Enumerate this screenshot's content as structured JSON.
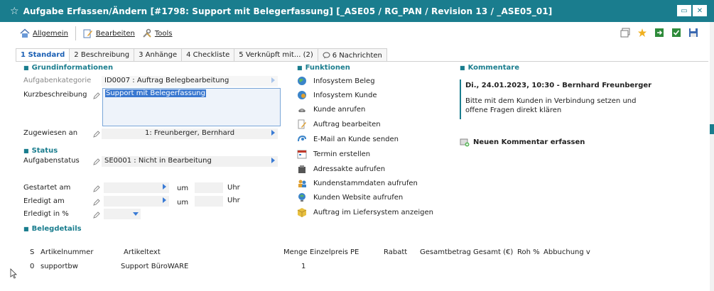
{
  "window": {
    "title": "Aufgabe Erfassen/Ändern [#1798: Support mit Belegerfassung] [_ASE05 / RG_PAN / Revision 13 / _ASE05_01]",
    "restore_label": "▭",
    "close_label": "✕"
  },
  "toolbar": {
    "allgemein": "Allgemein",
    "bearbeiten": "Bearbeiten",
    "tools": "Tools"
  },
  "tabs": [
    {
      "label": "1 Standard"
    },
    {
      "label": "2 Beschreibung"
    },
    {
      "label": "3 Anhänge"
    },
    {
      "label": "4 Checkliste"
    },
    {
      "label": "5 Verknüpft mit... (2)"
    },
    {
      "label": "6 Nachrichten"
    }
  ],
  "grundinfo": {
    "heading": "Grundinformationen",
    "kategorie_label": "Aufgabenkategorie",
    "kategorie_value": "ID0007   : Auftrag Belegbearbeitung",
    "kurz_label": "Kurzbeschreibung",
    "kurz_value": "Support mit Belegerfassung",
    "zugewiesen_label": "Zugewiesen an",
    "zugewiesen_value": "1: Freunberger, Bernhard"
  },
  "status": {
    "heading": "Status",
    "status_label": "Aufgabenstatus",
    "status_value": "SE0001   : Nicht in Bearbeitung",
    "gestartet_label": "Gestartet am",
    "erledigt_label": "Erledigt am",
    "prozent_label": "Erledigt in %",
    "um_label": "um",
    "uhr_label": "Uhr"
  },
  "belegdetails": {
    "heading": "Belegdetails",
    "columns": [
      "S",
      "Artikelnummer",
      "Artikeltext",
      "Menge",
      "Einzelpreis",
      "PE",
      "Rabatt",
      "Gesamtbetrag",
      "Gesamt (€)",
      "Roh %",
      "Abbuchung v"
    ],
    "rows": [
      {
        "s": "0",
        "artikelnummer": "supportbw",
        "artikeltext": "Support BüroWARE",
        "menge": "1"
      }
    ]
  },
  "funktionen": {
    "heading": "Funktionen",
    "items": [
      {
        "label": "Infosystem Beleg",
        "icon": "globe-icon"
      },
      {
        "label": "Infosystem Kunde",
        "icon": "globe-person-icon"
      },
      {
        "label": "Kunde anrufen",
        "icon": "phone-icon"
      },
      {
        "label": "Auftrag bearbeiten",
        "icon": "document-edit-icon"
      },
      {
        "label": "E-Mail an Kunde senden",
        "icon": "email-icon"
      },
      {
        "label": "Termin erstellen",
        "icon": "calendar-icon"
      },
      {
        "label": "Adressakte aufrufen",
        "icon": "folder-icon"
      },
      {
        "label": "Kundenstammdaten aufrufen",
        "icon": "people-icon"
      },
      {
        "label": "Kunden Website aufrufen",
        "icon": "website-icon"
      },
      {
        "label": "Auftrag im Liefersystem anzeigen",
        "icon": "package-icon"
      }
    ]
  },
  "kommentare": {
    "heading": "Kommentare",
    "entry_header": "Di., 24.01.2023, 10:30 - Bernhard Freunberger",
    "entry_body": "Bitte mit dem Kunden in Verbindung setzen und offene Fragen direkt klären",
    "new_label": "Neuen Kommentar erfassen"
  },
  "colors": {
    "accent": "#1a7d8e",
    "link_blue": "#1a5fb4",
    "selection": "#3a78d0"
  }
}
